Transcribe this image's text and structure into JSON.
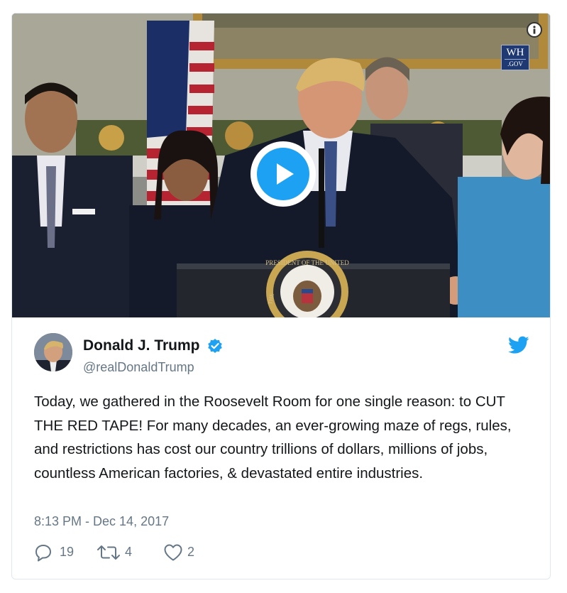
{
  "video": {
    "overlay_logo": {
      "line1": "WH",
      "line2": ".GOV"
    },
    "play_icon": "play-icon",
    "info_icon": "info-icon",
    "seal_text_top": "PRESIDENT OF THE UNITED",
    "seal_text_left": "THE"
  },
  "author": {
    "display_name": "Donald J. Trump",
    "handle": "@realDonaldTrump",
    "verified_icon": "verified-badge-icon",
    "avatar_icon": "avatar"
  },
  "brand_icon": "twitter-bird-icon",
  "tweet": {
    "text": "Today, we gathered in the Roosevelt Room for one single reason: to CUT THE RED TAPE! For many decades, an ever-growing maze of regs, rules, and restrictions has cost our country trillions of dollars, millions of jobs, countless American factories, & devastated entire industries.",
    "timestamp": "8:13 PM - Dec 14, 2017"
  },
  "actions": {
    "reply": {
      "icon": "reply-icon",
      "count": "19"
    },
    "retweet": {
      "icon": "retweet-icon",
      "count": "4"
    },
    "like": {
      "icon": "heart-icon",
      "count": "2"
    }
  },
  "colors": {
    "accent": "#1da1f2",
    "text": "#14171a",
    "muted": "#657786",
    "border": "#e1e8ed"
  }
}
